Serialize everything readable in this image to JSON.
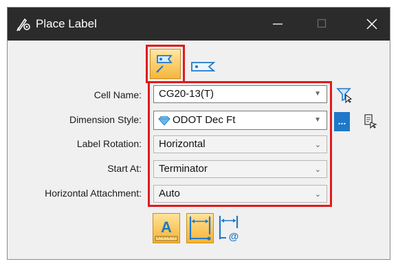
{
  "window": {
    "title": "Place Label",
    "icons": {
      "app": "pen-gear-icon",
      "minimize": "minimize-icon",
      "maximize": "maximize-icon",
      "close": "close-icon"
    }
  },
  "modes": {
    "place_label": {
      "icon": "place-label-icon",
      "selected": true
    },
    "alt_label": {
      "icon": "label-tag-icon",
      "selected": false
    }
  },
  "form": {
    "cell_name": {
      "label": "Cell Name:",
      "value": "CG20-13(T)"
    },
    "dimension_style": {
      "label": "Dimension Style:",
      "value": "ODOT Dec Ft",
      "more": "..."
    },
    "label_rotation": {
      "label": "Label Rotation:",
      "value": "Horizontal"
    },
    "start_at": {
      "label": "Start At:",
      "value": "Terminator"
    },
    "horizontal_attachment": {
      "label": "Horizontal Attachment:",
      "value": "Auto"
    }
  },
  "bottom_buttons": [
    {
      "icon": "text-a-icon",
      "selected": true
    },
    {
      "icon": "dimension-line-icon",
      "selected": true
    },
    {
      "icon": "dimension-at-icon",
      "selected": false
    }
  ],
  "colors": {
    "accent": "#e0191c",
    "selected_fill": "#f6b63b",
    "titlebar": "#2b2b2b",
    "blue": "#1f78c8"
  }
}
